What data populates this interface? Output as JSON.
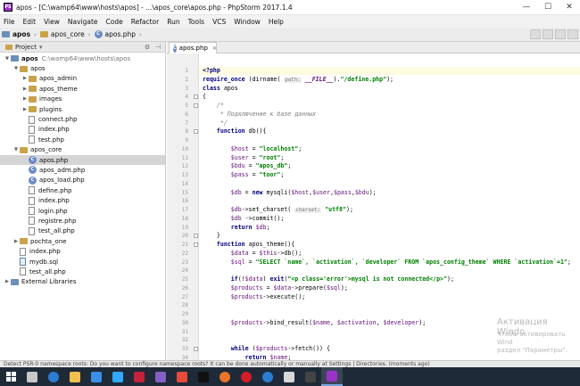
{
  "window": {
    "title": "apos - [C:\\wamp64\\www\\hosts\\apos] - ...\\apos_core\\apos.php - PhpStorm 2017.1.4",
    "app_icon_text": "PS",
    "minimize": "—",
    "maximize": "☐",
    "close": "✕"
  },
  "menu": [
    "File",
    "Edit",
    "View",
    "Navigate",
    "Code",
    "Refactor",
    "Run",
    "Tools",
    "VCS",
    "Window",
    "Help"
  ],
  "breadcrumb": [
    "apos",
    "apos_core",
    "apos.php"
  ],
  "project_panel": {
    "title": "Project",
    "dropdown": "▾",
    "tree": [
      {
        "label": "apos",
        "path": "C:\\wamp64\\www\\hosts\\apos",
        "type": "folder",
        "depth": 0,
        "open": true
      },
      {
        "label": "apos",
        "type": "folder",
        "depth": 1,
        "open": true
      },
      {
        "label": "apos_admin",
        "type": "folder",
        "depth": 2,
        "open": false
      },
      {
        "label": "apos_theme",
        "type": "folder",
        "depth": 2,
        "open": false
      },
      {
        "label": "images",
        "type": "folder",
        "depth": 2,
        "open": false
      },
      {
        "label": "plugins",
        "type": "folder",
        "depth": 2,
        "open": false
      },
      {
        "label": "connect.php",
        "type": "file",
        "depth": 2
      },
      {
        "label": "index.php",
        "type": "file",
        "depth": 2
      },
      {
        "label": "test.php",
        "type": "file",
        "depth": 2
      },
      {
        "label": "apos_core",
        "type": "folder",
        "depth": 1,
        "open": true
      },
      {
        "label": "apos.php",
        "type": "php",
        "depth": 2,
        "selected": true
      },
      {
        "label": "apos_adm.php",
        "type": "php",
        "depth": 2
      },
      {
        "label": "apos_load.php",
        "type": "php",
        "depth": 2
      },
      {
        "label": "define.php",
        "type": "file",
        "depth": 2
      },
      {
        "label": "index.php",
        "type": "file",
        "depth": 2
      },
      {
        "label": "login.php",
        "type": "file",
        "depth": 2
      },
      {
        "label": "registre.php",
        "type": "file",
        "depth": 2
      },
      {
        "label": "test_all.php",
        "type": "file",
        "depth": 2
      },
      {
        "label": "pochta_one",
        "type": "folder",
        "depth": 1,
        "open": false
      },
      {
        "label": "index.php",
        "type": "file",
        "depth": 1
      },
      {
        "label": "mydb.sql",
        "type": "sql",
        "depth": 1
      },
      {
        "label": "test_all.php",
        "type": "file",
        "depth": 1
      },
      {
        "label": "External Libraries",
        "type": "lib",
        "depth": 0,
        "open": false
      }
    ]
  },
  "editor": {
    "tab_label": "apos.php",
    "lines": [
      "<?php",
      "require_once (dirname( path: __FILE__).\"/define.php\");",
      "class apos",
      "{",
      "    /*",
      "     * Подключение к базе данных",
      "     */",
      "    function db(){",
      "",
      "        $host = \"localhost\";",
      "        $user = \"root\";",
      "        $bdu = \"apos_db\";",
      "        $pass = \"toor\";",
      "",
      "        $db = new mysqli($host,$user,$pass,$bdu);",
      "",
      "        $db->set_charset( charset: \"utf8\");",
      "        $db ->commit();",
      "        return $db;",
      "    }",
      "    function apos_theme(){",
      "        $data = $this->db();",
      "        $sql = \"SELECT `name`, `activation`, `developer` FROM `apos_config_theme` WHERE `activation`=1\";",
      "",
      "        if(!$data) exit(\"<p class='error'>mysql is not connected</p>\");",
      "        $products = $data->prepare($sql);",
      "        $products->execute();",
      "",
      "",
      "        $products->bind_result($name, $activation, $developer);",
      "",
      "",
      "        while ($products->fetch()) {",
      "            return $name;"
    ]
  },
  "watermark": {
    "title": "Активация Windo",
    "line1": "Чтобы активировать Wind",
    "line2": "раздел \"Параметры\"."
  },
  "status_bar": "Detect PSR-0 namespace roots: Do you want to configure namespace roots? It can be done automatically or manually at Settings | Directories. (moments ago)",
  "taskbar": [
    {
      "icon": "windows-start-icon",
      "color": "#ffffff"
    },
    {
      "icon": "task-view-icon",
      "color": "#c8c8c8"
    },
    {
      "icon": "edge-icon",
      "color": "#2b7cd3"
    },
    {
      "icon": "explorer-icon",
      "color": "#f2c14e"
    },
    {
      "icon": "store-icon",
      "color": "#3a8ee6"
    },
    {
      "icon": "photoshop-icon",
      "color": "#31a8ff"
    },
    {
      "icon": "acrobat-icon",
      "color": "#c5203d"
    },
    {
      "icon": "visual-studio-icon",
      "color": "#865fc5"
    },
    {
      "icon": "app-icon",
      "color": "#e64b3c"
    },
    {
      "icon": "terminal-icon",
      "color": "#111111"
    },
    {
      "icon": "firefox-icon",
      "color": "#e8742a"
    },
    {
      "icon": "opera-icon",
      "color": "#d61c2b"
    },
    {
      "icon": "edge-icon-2",
      "color": "#2b7cd3"
    },
    {
      "icon": "settings-icon",
      "color": "#d8d8d8"
    },
    {
      "icon": "media-icon",
      "color": "#444444"
    },
    {
      "icon": "phpstorm-icon",
      "color": "#9c33c9"
    }
  ]
}
